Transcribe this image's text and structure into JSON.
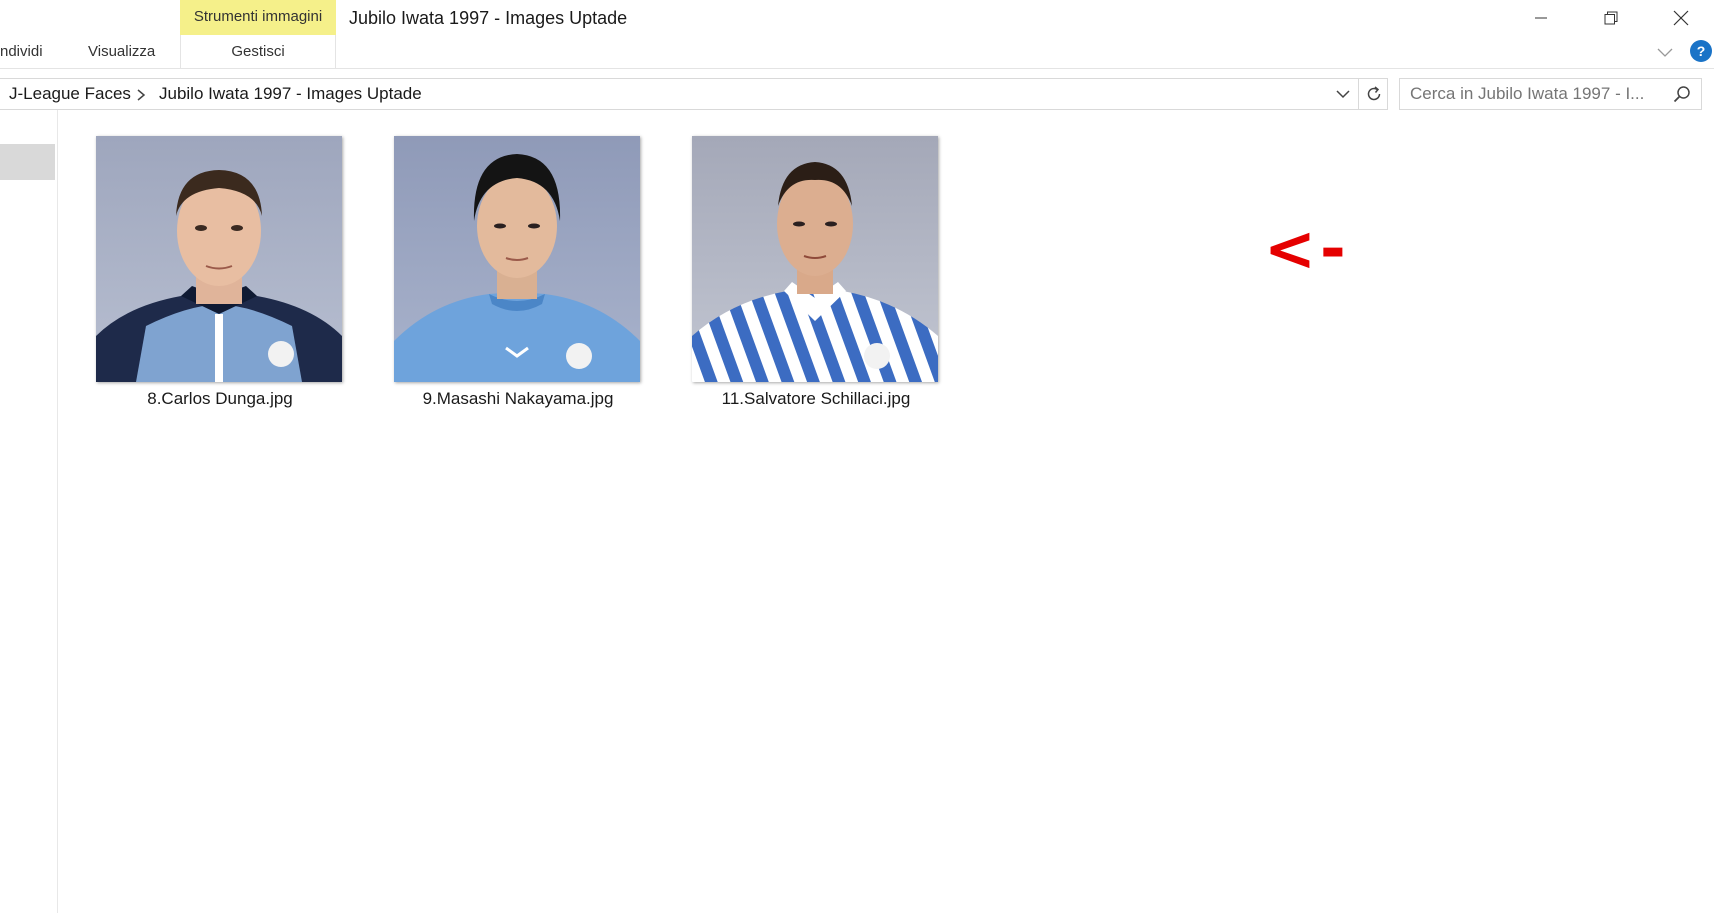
{
  "window": {
    "title": "Jubilo Iwata 1997 - Images Uptade",
    "context_tab_header": "Strumenti immagini",
    "minimize_icon": "minimize-icon",
    "restore_icon": "restore-icon",
    "close_icon": "close-icon"
  },
  "ribbon": {
    "tabs": [
      {
        "label": "ndividi"
      },
      {
        "label": "Visualizza"
      }
    ],
    "context_tab": "Gestisci",
    "collapse_icon": "chevron-down-icon",
    "help_icon": "help-icon"
  },
  "address": {
    "crumbs": [
      "J-League Faces",
      "Jubilo Iwata 1997 - Images Uptade"
    ],
    "separator": ">",
    "dropdown_icon": "chevron-down-icon",
    "refresh_icon": "refresh-icon"
  },
  "search": {
    "placeholder": "Cerca in Jubilo Iwata 1997 - I...",
    "icon": "search-icon"
  },
  "files": [
    {
      "name": "8.Carlos Dunga.jpg",
      "kit": "navy-collar"
    },
    {
      "name": "9.Masashi Nakayama.jpg",
      "kit": "light-blue"
    },
    {
      "name": "11.Salvatore Schillaci.jpg",
      "kit": "striped"
    }
  ],
  "annotation": {
    "text": "<-",
    "color": "#e50000"
  },
  "colors": {
    "context_tab": "#f5f08a",
    "help_blue": "#1a73c7"
  }
}
